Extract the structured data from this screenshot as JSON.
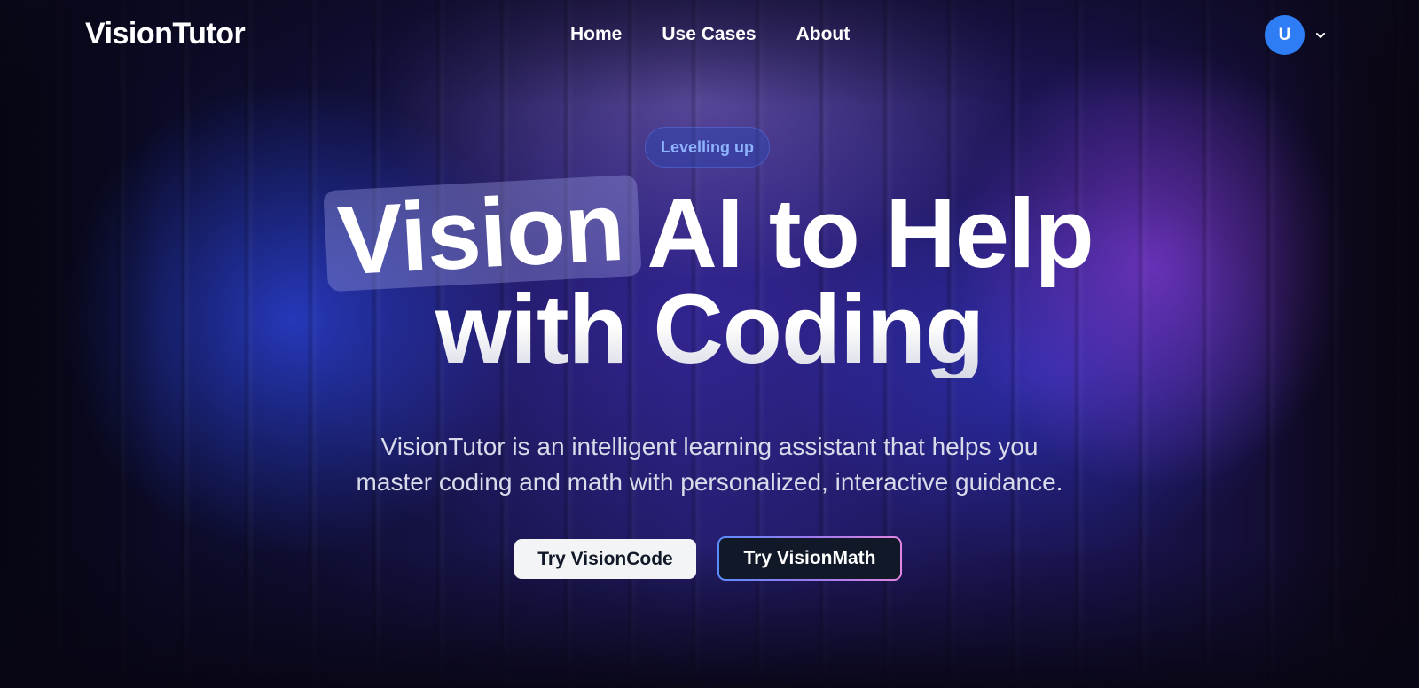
{
  "header": {
    "logo": "VisionTutor",
    "nav": [
      {
        "label": "Home"
      },
      {
        "label": "Use Cases"
      },
      {
        "label": "About"
      }
    ],
    "user": {
      "avatar_initial": "U",
      "avatar_color": "#2f7df5",
      "menu_icon": "chevron-down-icon"
    }
  },
  "hero": {
    "badge": "Levelling up",
    "headline": {
      "highlight": "Vision",
      "line1_rest": "AI to Help",
      "line2": "with Coding"
    },
    "subtitle": {
      "line1": "VisionTutor is an intelligent learning assistant that helps you",
      "line2": "master coding and math with personalized, interactive guidance."
    },
    "cta": {
      "primary": "Try VisionCode",
      "secondary": "Try VisionMath"
    }
  },
  "colors": {
    "accent_blue": "#2f7df5",
    "badge_text": "#8fb4ff",
    "button_dark": "#111827",
    "button_light": "#f3f4f6"
  }
}
